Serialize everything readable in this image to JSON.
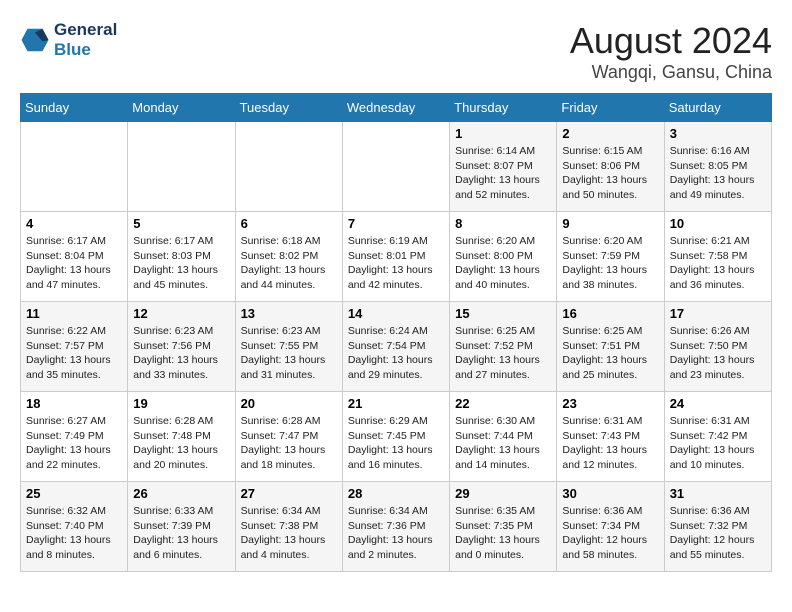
{
  "header": {
    "logo_line1": "General",
    "logo_line2": "Blue",
    "title": "August 2024",
    "subtitle": "Wangqi, Gansu, China"
  },
  "days_of_week": [
    "Sunday",
    "Monday",
    "Tuesday",
    "Wednesday",
    "Thursday",
    "Friday",
    "Saturday"
  ],
  "weeks": [
    [
      {
        "num": "",
        "info": ""
      },
      {
        "num": "",
        "info": ""
      },
      {
        "num": "",
        "info": ""
      },
      {
        "num": "",
        "info": ""
      },
      {
        "num": "1",
        "info": "Sunrise: 6:14 AM\nSunset: 8:07 PM\nDaylight: 13 hours\nand 52 minutes."
      },
      {
        "num": "2",
        "info": "Sunrise: 6:15 AM\nSunset: 8:06 PM\nDaylight: 13 hours\nand 50 minutes."
      },
      {
        "num": "3",
        "info": "Sunrise: 6:16 AM\nSunset: 8:05 PM\nDaylight: 13 hours\nand 49 minutes."
      }
    ],
    [
      {
        "num": "4",
        "info": "Sunrise: 6:17 AM\nSunset: 8:04 PM\nDaylight: 13 hours\nand 47 minutes."
      },
      {
        "num": "5",
        "info": "Sunrise: 6:17 AM\nSunset: 8:03 PM\nDaylight: 13 hours\nand 45 minutes."
      },
      {
        "num": "6",
        "info": "Sunrise: 6:18 AM\nSunset: 8:02 PM\nDaylight: 13 hours\nand 44 minutes."
      },
      {
        "num": "7",
        "info": "Sunrise: 6:19 AM\nSunset: 8:01 PM\nDaylight: 13 hours\nand 42 minutes."
      },
      {
        "num": "8",
        "info": "Sunrise: 6:20 AM\nSunset: 8:00 PM\nDaylight: 13 hours\nand 40 minutes."
      },
      {
        "num": "9",
        "info": "Sunrise: 6:20 AM\nSunset: 7:59 PM\nDaylight: 13 hours\nand 38 minutes."
      },
      {
        "num": "10",
        "info": "Sunrise: 6:21 AM\nSunset: 7:58 PM\nDaylight: 13 hours\nand 36 minutes."
      }
    ],
    [
      {
        "num": "11",
        "info": "Sunrise: 6:22 AM\nSunset: 7:57 PM\nDaylight: 13 hours\nand 35 minutes."
      },
      {
        "num": "12",
        "info": "Sunrise: 6:23 AM\nSunset: 7:56 PM\nDaylight: 13 hours\nand 33 minutes."
      },
      {
        "num": "13",
        "info": "Sunrise: 6:23 AM\nSunset: 7:55 PM\nDaylight: 13 hours\nand 31 minutes."
      },
      {
        "num": "14",
        "info": "Sunrise: 6:24 AM\nSunset: 7:54 PM\nDaylight: 13 hours\nand 29 minutes."
      },
      {
        "num": "15",
        "info": "Sunrise: 6:25 AM\nSunset: 7:52 PM\nDaylight: 13 hours\nand 27 minutes."
      },
      {
        "num": "16",
        "info": "Sunrise: 6:25 AM\nSunset: 7:51 PM\nDaylight: 13 hours\nand 25 minutes."
      },
      {
        "num": "17",
        "info": "Sunrise: 6:26 AM\nSunset: 7:50 PM\nDaylight: 13 hours\nand 23 minutes."
      }
    ],
    [
      {
        "num": "18",
        "info": "Sunrise: 6:27 AM\nSunset: 7:49 PM\nDaylight: 13 hours\nand 22 minutes."
      },
      {
        "num": "19",
        "info": "Sunrise: 6:28 AM\nSunset: 7:48 PM\nDaylight: 13 hours\nand 20 minutes."
      },
      {
        "num": "20",
        "info": "Sunrise: 6:28 AM\nSunset: 7:47 PM\nDaylight: 13 hours\nand 18 minutes."
      },
      {
        "num": "21",
        "info": "Sunrise: 6:29 AM\nSunset: 7:45 PM\nDaylight: 13 hours\nand 16 minutes."
      },
      {
        "num": "22",
        "info": "Sunrise: 6:30 AM\nSunset: 7:44 PM\nDaylight: 13 hours\nand 14 minutes."
      },
      {
        "num": "23",
        "info": "Sunrise: 6:31 AM\nSunset: 7:43 PM\nDaylight: 13 hours\nand 12 minutes."
      },
      {
        "num": "24",
        "info": "Sunrise: 6:31 AM\nSunset: 7:42 PM\nDaylight: 13 hours\nand 10 minutes."
      }
    ],
    [
      {
        "num": "25",
        "info": "Sunrise: 6:32 AM\nSunset: 7:40 PM\nDaylight: 13 hours\nand 8 minutes."
      },
      {
        "num": "26",
        "info": "Sunrise: 6:33 AM\nSunset: 7:39 PM\nDaylight: 13 hours\nand 6 minutes."
      },
      {
        "num": "27",
        "info": "Sunrise: 6:34 AM\nSunset: 7:38 PM\nDaylight: 13 hours\nand 4 minutes."
      },
      {
        "num": "28",
        "info": "Sunrise: 6:34 AM\nSunset: 7:36 PM\nDaylight: 13 hours\nand 2 minutes."
      },
      {
        "num": "29",
        "info": "Sunrise: 6:35 AM\nSunset: 7:35 PM\nDaylight: 13 hours\nand 0 minutes."
      },
      {
        "num": "30",
        "info": "Sunrise: 6:36 AM\nSunset: 7:34 PM\nDaylight: 12 hours\nand 58 minutes."
      },
      {
        "num": "31",
        "info": "Sunrise: 6:36 AM\nSunset: 7:32 PM\nDaylight: 12 hours\nand 55 minutes."
      }
    ]
  ]
}
